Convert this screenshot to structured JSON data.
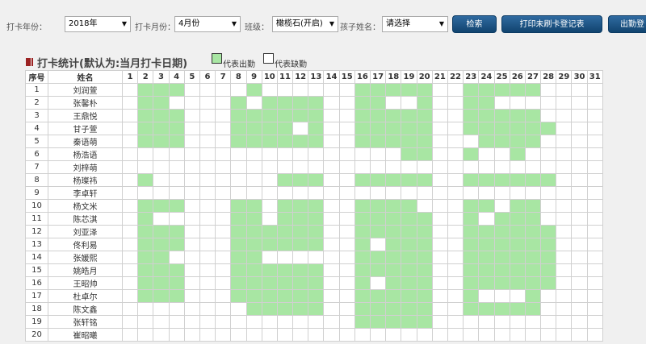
{
  "toolbar": {
    "year_label": "打卡年份：",
    "year_value": "2018年",
    "month_label": "打卡月份：",
    "month_value": "4月份",
    "class_label": "班级：",
    "class_value": "橄榄石(开启)",
    "child_label": "孩子姓名：",
    "child_value": "请选择",
    "search_button": "检索",
    "print_button": "打印未刷卡登记表",
    "attendance_button": "出勤登"
  },
  "section": {
    "title": "打卡统计(默认为:当月打卡日期)",
    "legend_present": "代表出勤",
    "legend_absent": "代表缺勤"
  },
  "colors": {
    "present": "#a8e6a3",
    "absent": "#ffffff",
    "button": "#1a4f7e"
  },
  "table": {
    "col_index": "序号",
    "col_name": "姓名",
    "days": [
      "1",
      "2",
      "3",
      "4",
      "5",
      "6",
      "7",
      "8",
      "9",
      "10",
      "11",
      "12",
      "13",
      "14",
      "15",
      "16",
      "17",
      "18",
      "19",
      "20",
      "21",
      "22",
      "23",
      "24",
      "25",
      "26",
      "27",
      "28",
      "29",
      "30",
      "31"
    ],
    "rows": [
      {
        "index": "1",
        "name": "刘润萱",
        "present": [
          2,
          3,
          4,
          9,
          16,
          17,
          18,
          19,
          20,
          23,
          24,
          25,
          26,
          27
        ]
      },
      {
        "index": "2",
        "name": "张馨朴",
        "present": [
          2,
          3,
          8,
          10,
          11,
          12,
          13,
          16,
          17,
          20,
          23,
          24
        ]
      },
      {
        "index": "3",
        "name": "王鼎悦",
        "present": [
          2,
          3,
          4,
          8,
          9,
          10,
          11,
          12,
          13,
          16,
          17,
          18,
          19,
          20,
          23,
          24,
          25,
          26,
          27
        ]
      },
      {
        "index": "4",
        "name": "甘子萱",
        "present": [
          2,
          3,
          4,
          8,
          9,
          10,
          11,
          13,
          16,
          17,
          18,
          19,
          20,
          23,
          24,
          25,
          26,
          27,
          28
        ]
      },
      {
        "index": "5",
        "name": "秦语萌",
        "present": [
          2,
          3,
          4,
          8,
          9,
          10,
          11,
          12,
          13,
          16,
          17,
          18,
          19,
          20,
          24,
          25,
          26,
          27
        ]
      },
      {
        "index": "6",
        "name": "杨浩语",
        "present": [
          19,
          20,
          23,
          26
        ]
      },
      {
        "index": "7",
        "name": "刘梓萌",
        "present": []
      },
      {
        "index": "8",
        "name": "杨璨祎",
        "present": [
          2,
          11,
          12,
          13,
          16,
          17,
          18,
          19,
          20,
          23,
          24,
          25,
          26,
          27,
          28
        ]
      },
      {
        "index": "9",
        "name": "李卓轩",
        "present": []
      },
      {
        "index": "10",
        "name": "杨文米",
        "present": [
          2,
          3,
          4,
          8,
          9,
          11,
          12,
          13,
          16,
          17,
          18,
          19,
          23,
          24,
          26,
          27
        ]
      },
      {
        "index": "11",
        "name": "陈芯淇",
        "present": [
          2,
          8,
          9,
          11,
          12,
          13,
          16,
          17,
          18,
          19,
          20,
          23,
          25,
          26,
          27
        ]
      },
      {
        "index": "12",
        "name": "刘亚泽",
        "present": [
          2,
          3,
          4,
          8,
          9,
          10,
          11,
          12,
          13,
          16,
          17,
          18,
          19,
          20,
          23,
          24,
          25,
          26,
          27,
          28
        ]
      },
      {
        "index": "13",
        "name": "佟利易",
        "present": [
          2,
          3,
          4,
          8,
          9,
          10,
          11,
          12,
          13,
          16,
          18,
          19,
          20,
          23,
          24,
          25,
          26,
          27,
          28
        ]
      },
      {
        "index": "14",
        "name": "张媛熙",
        "present": [
          2,
          3,
          8,
          9,
          16,
          17,
          18,
          19,
          20,
          23,
          24,
          25,
          26,
          27,
          28
        ]
      },
      {
        "index": "15",
        "name": "姚皓月",
        "present": [
          2,
          3,
          4,
          8,
          9,
          10,
          11,
          12,
          13,
          16,
          17,
          18,
          19,
          20,
          23,
          24,
          25,
          26,
          27,
          28
        ]
      },
      {
        "index": "16",
        "name": "王昭帅",
        "present": [
          2,
          3,
          4,
          8,
          9,
          10,
          11,
          12,
          13,
          16,
          18,
          19,
          20,
          23,
          24,
          25,
          26,
          27,
          28
        ]
      },
      {
        "index": "17",
        "name": "杜卓尔",
        "present": [
          2,
          3,
          4,
          8,
          9,
          10,
          11,
          12,
          13,
          16,
          17,
          18,
          19,
          20,
          23,
          27
        ]
      },
      {
        "index": "18",
        "name": "陈文鑫",
        "present": [
          9,
          10,
          11,
          12,
          13,
          16,
          17,
          18,
          19,
          20,
          23,
          24,
          25,
          26,
          27
        ]
      },
      {
        "index": "19",
        "name": "张轩铭",
        "present": [
          16,
          17,
          18,
          19,
          20
        ]
      },
      {
        "index": "20",
        "name": "崔昭曦",
        "present": []
      }
    ]
  }
}
